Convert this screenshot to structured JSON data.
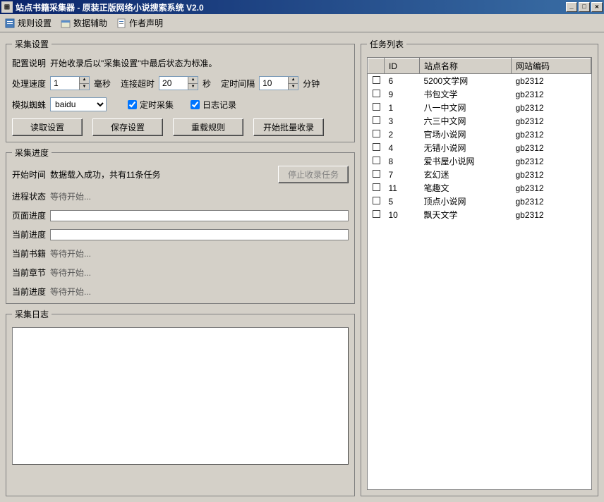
{
  "window": {
    "title": "站点书籍采集器 - 原装正版网络小说搜索系统 V2.0"
  },
  "toolbar": {
    "rules": "规则设置",
    "data": "数据辅助",
    "author": "作者声明"
  },
  "collect": {
    "legend": "采集设置",
    "config_label": "配置说明",
    "config_text": "开始收录后以\"采集设置\"中最后状态为标准。",
    "speed_label": "处理速度",
    "speed_value": "1",
    "speed_unit": "毫秒",
    "timeout_label": "连接超时",
    "timeout_value": "20",
    "timeout_unit": "秒",
    "interval_label": "定时间隔",
    "interval_value": "10",
    "interval_unit": "分钟",
    "spider_label": "模拟蜘蛛",
    "spider_value": "baidu",
    "timed_collect": "定时采集",
    "log_record": "日志记录",
    "btn_read": "读取设置",
    "btn_save": "保存设置",
    "btn_reload": "重载规则",
    "btn_start": "开始批量收录"
  },
  "progress": {
    "legend": "采集进度",
    "start_time_label": "开始时间",
    "start_time_value": "数据载入成功，共有11条任务",
    "btn_stop": "停止收录任务",
    "proc_state_label": "进程状态",
    "proc_state_value": "等待开始...",
    "page_prog_label": "页面进度",
    "curr_prog_label": "当前进度",
    "curr_book_label": "当前书籍",
    "curr_book_value": "等待开始...",
    "curr_chap_label": "当前章节",
    "curr_chap_value": "等待开始...",
    "curr_prog2_label": "当前进度",
    "curr_prog2_value": "等待开始..."
  },
  "log": {
    "legend": "采集日志"
  },
  "tasks": {
    "legend": "任务列表",
    "headers": {
      "id": "ID",
      "name": "站点名称",
      "encoding": "网站编码"
    },
    "rows": [
      {
        "id": "6",
        "name": "5200文学网",
        "encoding": "gb2312"
      },
      {
        "id": "9",
        "name": "书包文学",
        "encoding": "gb2312"
      },
      {
        "id": "1",
        "name": "八一中文网",
        "encoding": "gb2312"
      },
      {
        "id": "3",
        "name": "六三中文网",
        "encoding": "gb2312"
      },
      {
        "id": "2",
        "name": "官场小说网",
        "encoding": "gb2312"
      },
      {
        "id": "4",
        "name": "无错小说网",
        "encoding": "gb2312"
      },
      {
        "id": "8",
        "name": "爱书屋小说网",
        "encoding": "gb2312"
      },
      {
        "id": "7",
        "name": "玄幻迷",
        "encoding": "gb2312"
      },
      {
        "id": "11",
        "name": "笔趣文",
        "encoding": "gb2312"
      },
      {
        "id": "5",
        "name": "顶点小说网",
        "encoding": "gb2312"
      },
      {
        "id": "10",
        "name": "飘天文学",
        "encoding": "gb2312"
      }
    ]
  }
}
